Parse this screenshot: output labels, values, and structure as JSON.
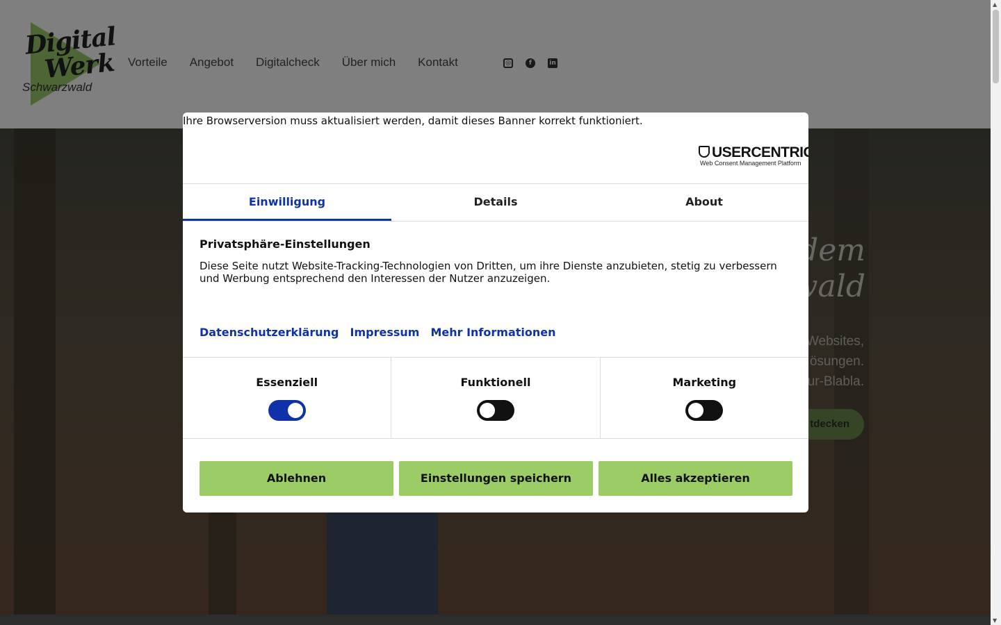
{
  "site": {
    "logo": {
      "line1": "Digital",
      "line2": "Werk",
      "line3": "Schwarzwald"
    },
    "nav": [
      "Vorteile",
      "Angebot",
      "Digitalcheck",
      "Über mich",
      "Kontakt"
    ],
    "social": [
      "instagram-icon",
      "facebook-icon",
      "linkedin-icon"
    ],
    "hero": {
      "title_line1": "t dem",
      "title_line2": "zwald",
      "text_line1": "Websites,",
      "text_line2": "ösungen.",
      "text_line3": "ur-Blabla.",
      "button": "tdecken"
    }
  },
  "consent": {
    "browser_warning": "Ihre Browserversion muss aktualisiert werden, damit dieses Banner korrekt funktioniert.",
    "brand": "USERCENTRICS",
    "brand_sub": "Web Consent Management Platform",
    "tabs": [
      "Einwilligung",
      "Details",
      "About"
    ],
    "active_tab": "Einwilligung",
    "heading": "Privatsphäre-Einstellungen",
    "body": "Diese Seite nutzt Website-Tracking-Technologien von Dritten, um ihre Dienste anzubieten, stetig zu verbessern und Werbung entsprechend den Interessen der Nutzer anzuzeigen.",
    "links": [
      "Datenschutzerklärung",
      "Impressum",
      "Mehr Informationen"
    ],
    "categories": [
      {
        "label": "Essenziell",
        "enabled": true
      },
      {
        "label": "Funktionell",
        "enabled": false
      },
      {
        "label": "Marketing",
        "enabled": false
      }
    ],
    "buttons": [
      "Ablehnen",
      "Einstellungen speichern",
      "Alles akzeptieren"
    ]
  },
  "colors": {
    "accent_blue": "#1032a8",
    "button_green": "#9ccc65"
  }
}
